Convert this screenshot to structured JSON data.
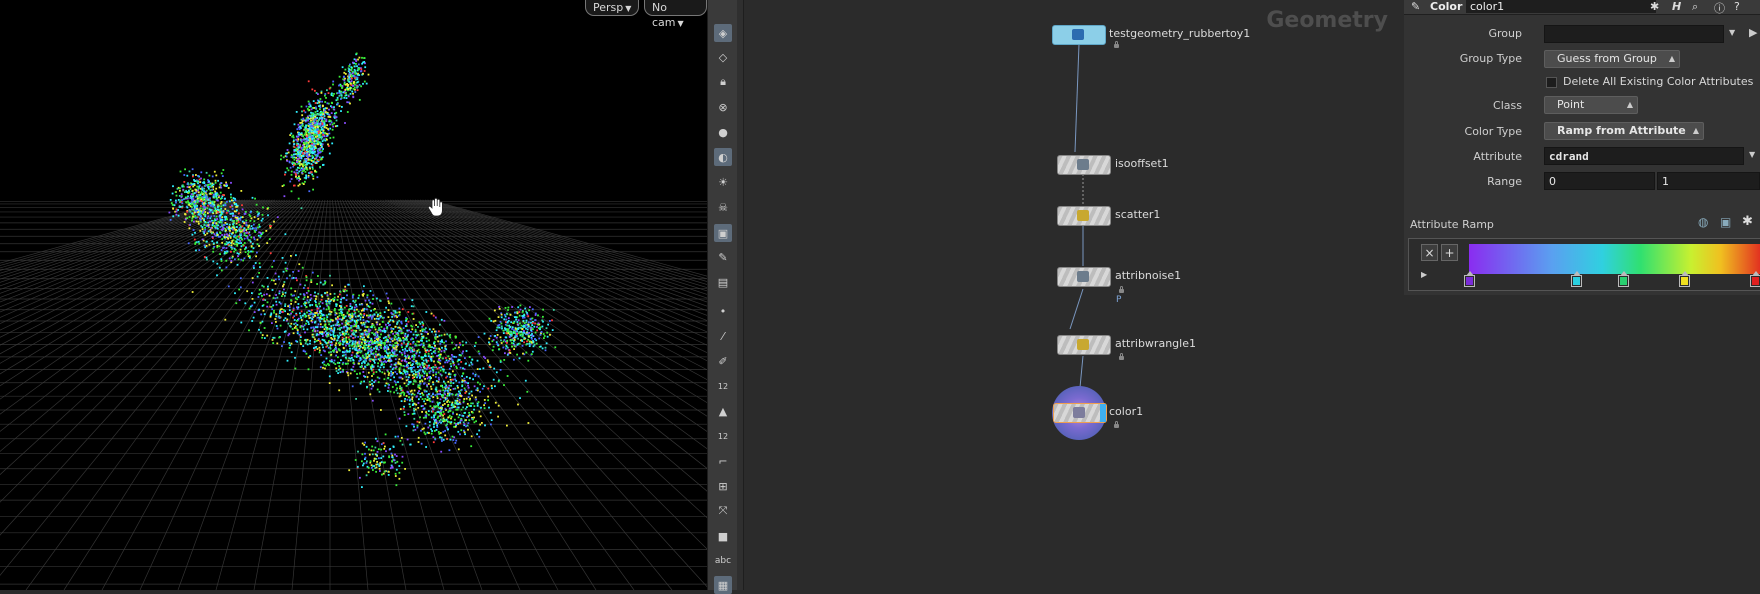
{
  "viewport": {
    "persp_label": "Persp",
    "cam_label": "No cam",
    "point_colors": [
      "#2ff0ff",
      "#3af03a",
      "#f0f03a",
      "#4a6aff",
      "#8a4dff",
      "#ff3a3a",
      "#3ad0a0"
    ]
  },
  "toolbar": {
    "icons": [
      "select-icon",
      "view-icon",
      "lock-icon",
      "snap-icon",
      "shading-icon",
      "light-icon",
      "bulb-icon",
      "camera-icon",
      "render-icon",
      "paint-icon",
      "flipbook-icon",
      "point-icon",
      "edge-icon",
      "brush-icon",
      "number-icon",
      "stamp-icon",
      "number2-icon",
      "curve-icon",
      "grid-icon",
      "pose-icon",
      "display-icon",
      "text-icon",
      "palette-icon"
    ],
    "num_label_1": "12",
    "num_label_2": "12",
    "abc_label": "abc"
  },
  "network": {
    "title": "Geometry",
    "nodes": [
      {
        "id": "testgeometry",
        "label": "testgeometry_rubbertoy1"
      },
      {
        "id": "isooffset",
        "label": "isooffset1"
      },
      {
        "id": "scatter",
        "label": "scatter1"
      },
      {
        "id": "attribnoise",
        "label": "attribnoise1",
        "sub": "P"
      },
      {
        "id": "attribwrangle",
        "label": "attribwrangle1"
      },
      {
        "id": "color",
        "label": "color1"
      }
    ]
  },
  "params": {
    "node_type": "Color",
    "node_name": "color1",
    "group_label": "Group",
    "group_value": "",
    "group_type_label": "Group Type",
    "group_type_value": "Guess from Group",
    "delete_attrs_label": "Delete All Existing Color Attributes",
    "class_label": "Class",
    "class_value": "Point",
    "color_type_label": "Color Type",
    "color_type_value": "Ramp from Attribute",
    "attribute_label": "Attribute",
    "attribute_value": "cdrand",
    "range_label": "Range",
    "range_min": "0",
    "range_max": "1",
    "ramp_label": "Attribute Ramp",
    "ramp_key_colors": [
      "#7a2cd8",
      "#2ad0e0",
      "#2ad070",
      "#f0e020",
      "#e02020"
    ]
  }
}
